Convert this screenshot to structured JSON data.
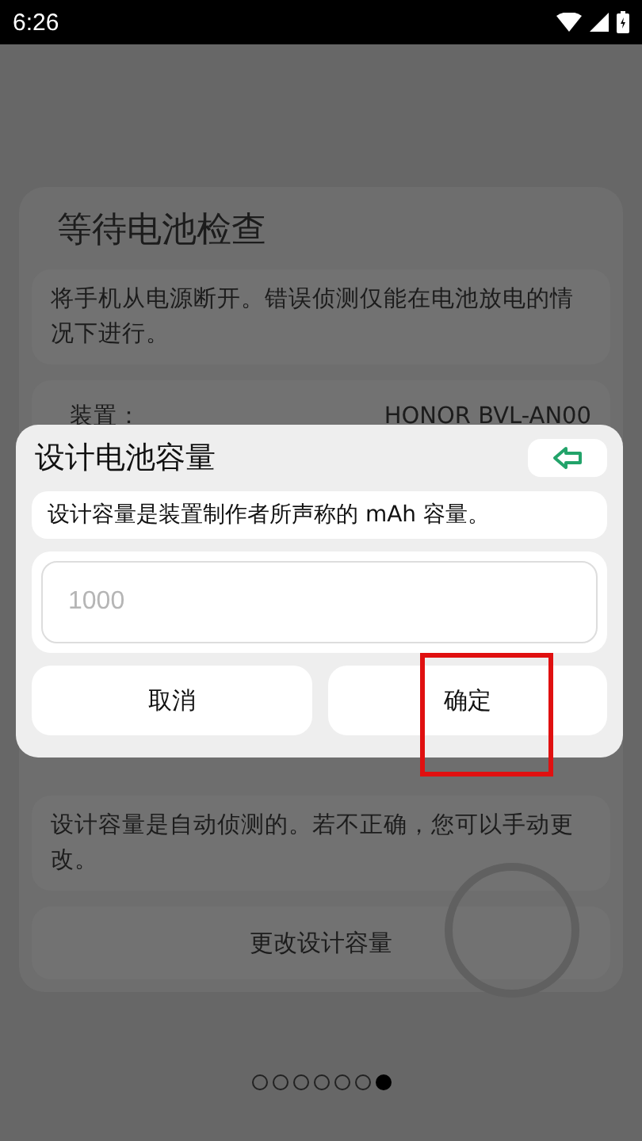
{
  "status_bar": {
    "time": "6:26"
  },
  "card": {
    "title": "等待电池检查",
    "notice": "将手机从电源断开。错误侦测仅能在电池放电的情况下进行。",
    "device_label": "装置：",
    "device_value": "HONOR BVL-AN00",
    "auto_note": "设计容量是自动侦测的。若不正确，您可以手动更改。",
    "change_button": "更改设计容量"
  },
  "dialog": {
    "title": "设计电池容量",
    "description": "设计容量是装置制作者所声称的 mAh 容量。",
    "placeholder": "1000",
    "buttons": [
      {
        "label": "取消",
        "highlighted": false
      },
      {
        "label": "确定",
        "highlighted": true
      }
    ]
  },
  "page_dots": [
    {
      "selected": false
    },
    {
      "selected": false
    },
    {
      "selected": false
    },
    {
      "selected": false
    },
    {
      "selected": false
    },
    {
      "selected": false
    },
    {
      "selected": true
    }
  ]
}
